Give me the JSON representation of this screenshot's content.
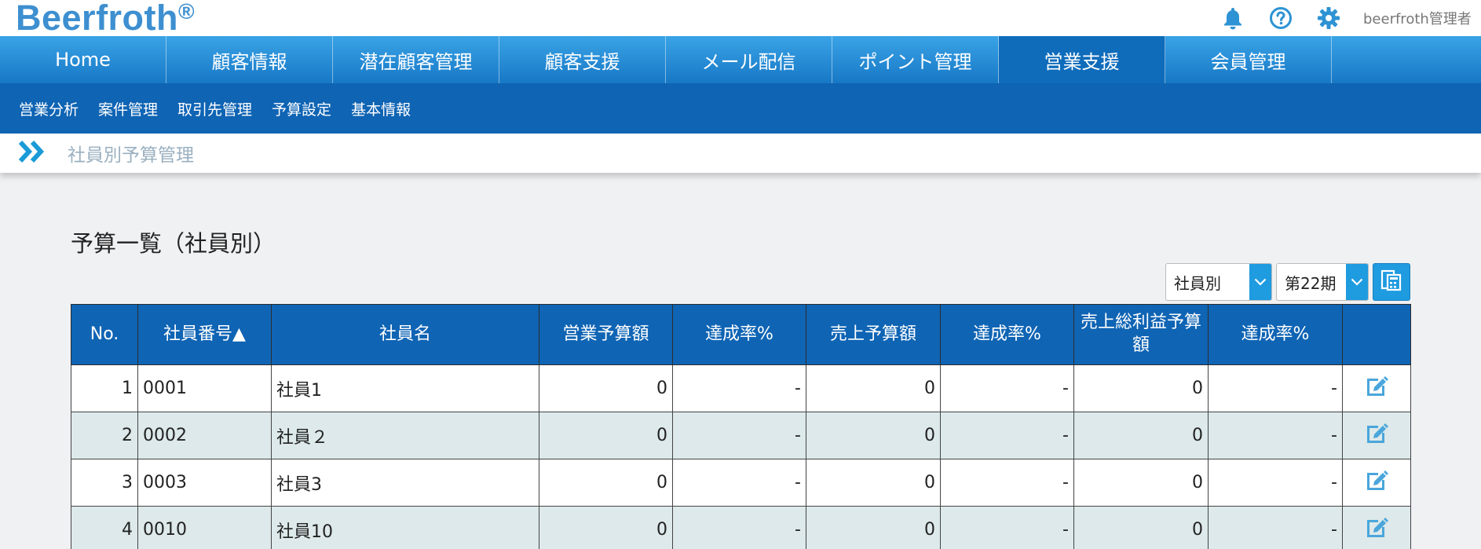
{
  "header": {
    "logo": "Beerfroth",
    "logo_mark": "®",
    "user_name": "beerfroth管理者",
    "icons": [
      "bell-icon",
      "help-icon",
      "gear-icon"
    ]
  },
  "main_nav": {
    "items": [
      {
        "label": "Home"
      },
      {
        "label": "顧客情報"
      },
      {
        "label": "潜在顧客管理"
      },
      {
        "label": "顧客支援"
      },
      {
        "label": "メール配信"
      },
      {
        "label": "ポイント管理"
      },
      {
        "label": "営業支援"
      },
      {
        "label": "会員管理"
      }
    ],
    "active": "営業支援"
  },
  "sub_nav": {
    "items": [
      {
        "label": "営業分析"
      },
      {
        "label": "案件管理"
      },
      {
        "label": "取引先管理"
      },
      {
        "label": "予算設定"
      },
      {
        "label": "基本情報"
      }
    ]
  },
  "breadcrumb": {
    "title": "社員別予算管理"
  },
  "section": {
    "title": "予算一覧（社員別）"
  },
  "controls": {
    "view_select": "社員別",
    "period_select": "第22期"
  },
  "table": {
    "headers": {
      "no": "No.",
      "emp_no": "社員番号▲",
      "emp_name": "社員名",
      "sales_budget": "営業予算額",
      "rate1": "達成率%",
      "revenue_budget": "売上予算額",
      "rate2": "達成率%",
      "gross_budget": "売上総利益予算額",
      "rate3": "達成率%"
    },
    "rows": [
      {
        "no": "1",
        "emp_no": "0001",
        "emp_name": "社員1",
        "sales_budget": "0",
        "rate1": "-",
        "revenue_budget": "0",
        "rate2": "-",
        "gross_budget": "0",
        "rate3": "-"
      },
      {
        "no": "2",
        "emp_no": "0002",
        "emp_name": "社員２",
        "sales_budget": "0",
        "rate1": "-",
        "revenue_budget": "0",
        "rate2": "-",
        "gross_budget": "0",
        "rate3": "-"
      },
      {
        "no": "3",
        "emp_no": "0003",
        "emp_name": "社員3",
        "sales_budget": "0",
        "rate1": "-",
        "revenue_budget": "0",
        "rate2": "-",
        "gross_budget": "0",
        "rate3": "-"
      },
      {
        "no": "4",
        "emp_no": "0010",
        "emp_name": "社員10",
        "sales_budget": "0",
        "rate1": "-",
        "revenue_budget": "0",
        "rate2": "-",
        "gross_budget": "0",
        "rate3": "-"
      }
    ]
  },
  "colors": {
    "nav_gradient_top": "#3aa3e6",
    "nav_active": "#0f6cbb",
    "subnav": "#0f64b4",
    "table_header": "#0f64b4",
    "row_alt": "#dde9ea",
    "accent": "#1f9be0",
    "logo": "#3d8fd0"
  }
}
